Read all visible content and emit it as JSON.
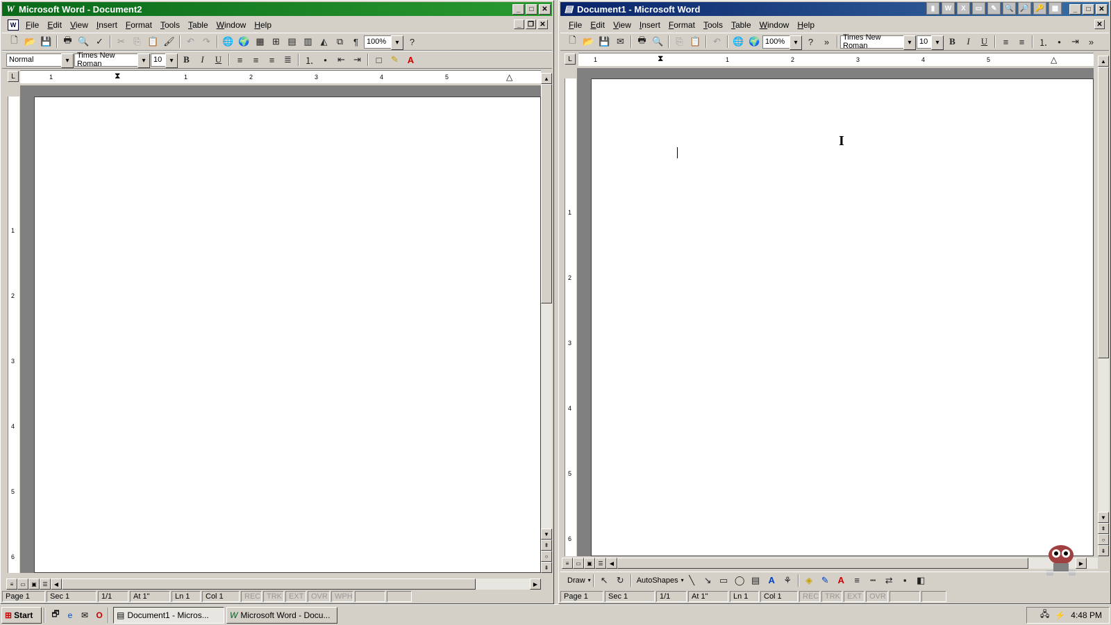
{
  "left_window": {
    "title": "Microsoft Word - Document2",
    "menu": [
      "File",
      "Edit",
      "View",
      "Insert",
      "Format",
      "Tools",
      "Table",
      "Window",
      "Help"
    ],
    "style": "Normal",
    "font": "Times New Roman",
    "size": "10",
    "zoom": "100%",
    "ruler_numbers": [
      "1",
      "1",
      "2",
      "3",
      "4",
      "5"
    ],
    "vruler_numbers": [
      "1",
      "2",
      "3",
      "4",
      "5",
      "6"
    ],
    "status": {
      "page": "Page 1",
      "sec": "Sec 1",
      "pages": "1/1",
      "at": "At 1\"",
      "ln": "Ln 1",
      "col": "Col 1",
      "rec": "REC",
      "trk": "TRK",
      "ext": "EXT",
      "ovr": "OVR",
      "wph": "WPH"
    }
  },
  "right_window": {
    "title": "Document1 - Microsoft Word",
    "menu": [
      "File",
      "Edit",
      "View",
      "Insert",
      "Format",
      "Tools",
      "Table",
      "Window",
      "Help"
    ],
    "font": "Times New Roman",
    "size": "10",
    "zoom": "100%",
    "ruler_numbers": [
      "1",
      "1",
      "2",
      "3",
      "4",
      "5"
    ],
    "vruler_numbers": [
      "1",
      "2",
      "3",
      "4",
      "5",
      "6"
    ],
    "drawbar": {
      "draw": "Draw",
      "autoshapes": "AutoShapes"
    },
    "status": {
      "page": "Page 1",
      "sec": "Sec 1",
      "pages": "1/1",
      "at": "At 1\"",
      "ln": "Ln 1",
      "col": "Col 1",
      "rec": "REC",
      "trk": "TRK",
      "ext": "EXT",
      "ovr": "OVR"
    }
  },
  "taskbar": {
    "start": "Start",
    "tasks": [
      "Document1 - Micros...",
      "Microsoft Word - Docu..."
    ],
    "clock": "4:48 PM"
  },
  "colors": {
    "active_title": "#0a246a",
    "inactive_title": "#0a6a1a",
    "face": "#d4d0c8"
  }
}
